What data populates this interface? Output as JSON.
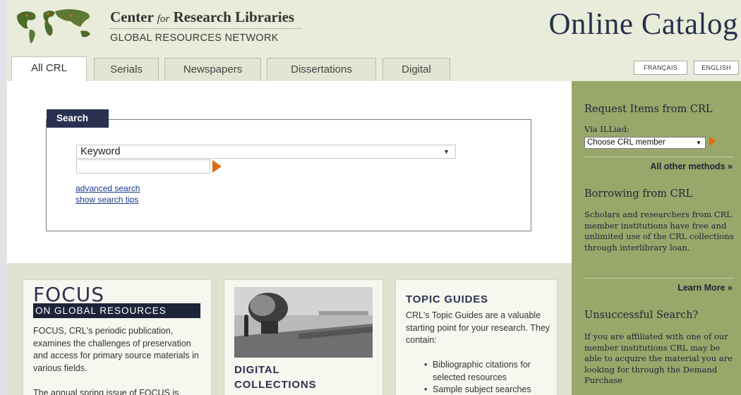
{
  "header": {
    "brand_line1_a": "Center ",
    "brand_line1_for": "for",
    "brand_line1_b": " Research Libraries",
    "brand_line2": "GLOBAL RESOURCES NETWORK",
    "catalog_title": "Online Catalog",
    "logo_icon": "world-map-icon"
  },
  "tabs": [
    {
      "label": "All CRL",
      "active": true
    },
    {
      "label": "Serials",
      "active": false
    },
    {
      "label": "Newspapers",
      "active": false
    },
    {
      "label": "Dissertations",
      "active": false
    },
    {
      "label": "Digital",
      "active": false
    }
  ],
  "language": {
    "french": "FRANÇAIS",
    "english": "ENGLISH"
  },
  "search": {
    "tab_label": "Search",
    "type_selected": "Keyword",
    "query_value": "",
    "advanced_link": "advanced search",
    "tips_link": "show search tips"
  },
  "focus_card": {
    "word": "FOCUS",
    "bar": "ON GLOBAL RESOURCES",
    "para1": "FOCUS, CRL's periodic publication, examines the challenges of preservation and access for primary source materials in various fields.",
    "para2": "The annual spring issue of FOCUS is"
  },
  "digital_card": {
    "heading_line1": "DIGITAL",
    "heading_line2": "COLLECTIONS"
  },
  "topic_card": {
    "heading": "TOPIC GUIDES",
    "intro": "CRL's Topic Guides are a valuable starting point for your research. They contain:",
    "bullets": [
      "Bibliographic citations for selected resources",
      "Sample subject searches"
    ]
  },
  "sidebar": {
    "request_heading": "Request Items from CRL",
    "via_label": "Via ILLiad:",
    "member_select": "Choose CRL member",
    "all_methods_link": "All other methods »",
    "borrowing_heading": "Borrowing from CRL",
    "borrowing_text": "Scholars and researchers from CRL member institutions have free and unlimited use of the CRL collections through interlibrary loan.",
    "learn_more_link": "Learn More »",
    "unsuccessful_heading": "Unsuccessful Search?",
    "unsuccessful_text": "If you are affiliated with one of our member institutions CRL may be able to acquire the material you are looking for through the Demand Purchase"
  },
  "colors": {
    "navy": "#2a3150",
    "accent_orange": "#e06a10",
    "sidebar_green": "#99a76a",
    "header_bg": "#e9ecda"
  }
}
